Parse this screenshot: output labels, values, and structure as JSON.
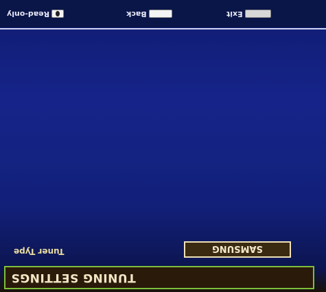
{
  "menu": {
    "title": "TUNING SETTINGS"
  },
  "settings": [
    {
      "label": "Tuner Type",
      "value": "SAMSUNG"
    }
  ],
  "footer": {
    "hints": [
      {
        "icon": "lock-key-icon",
        "label": "Read-only"
      },
      {
        "icon": "return-key-icon",
        "label": "Back"
      },
      {
        "icon": "exit-key-icon",
        "label": "Exit"
      }
    ]
  },
  "colors": {
    "background": "#16248a",
    "title_border": "#7fbf3a",
    "text": "#e8dca0"
  }
}
